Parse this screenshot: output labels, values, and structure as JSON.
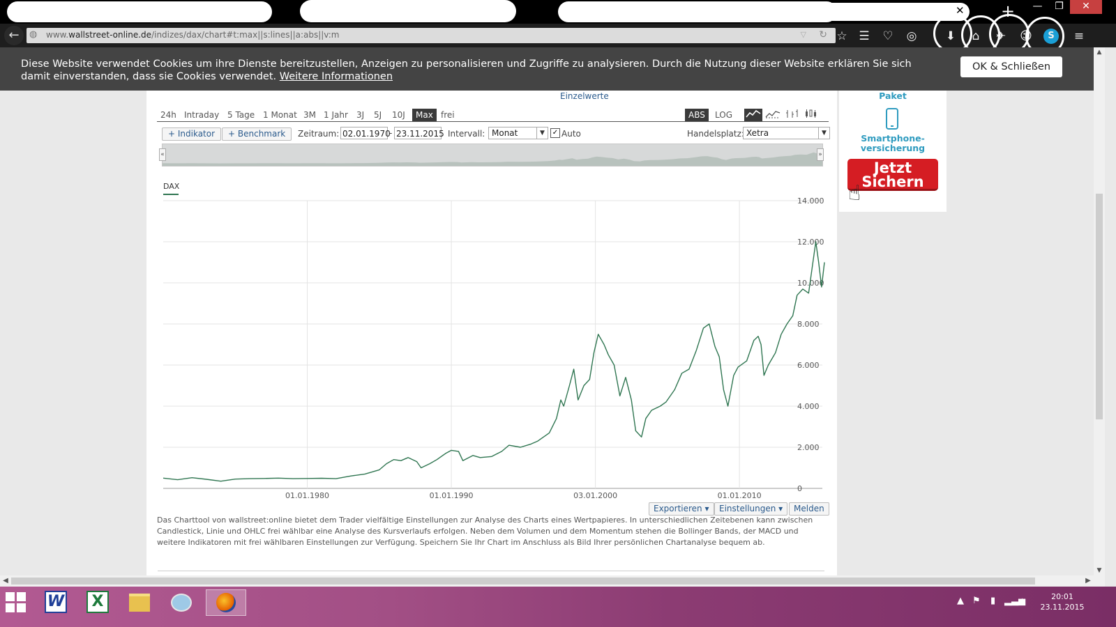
{
  "browser": {
    "tab_glyphs": {
      "close": "✕",
      "new_tab": "+",
      "minimize": "—",
      "restore": "❐",
      "close_window": "✕"
    },
    "url": {
      "prefix": "www.",
      "domain": "wallstreet-online.de",
      "path": "/indizes/dax/chart#t:max||s:lines||a:abs||v:m"
    },
    "toolbar_icons": [
      "star-icon",
      "reading-list-icon",
      "pocket-icon",
      "sync-icon",
      "download-icon",
      "home-icon",
      "send-icon",
      "chat-icon",
      "skype-icon",
      "menu-icon"
    ]
  },
  "cookie_banner": {
    "text": "Diese Website verwendet Cookies um ihre Dienste bereitzustellen, Anzeigen zu personalisieren und Zugriffe zu analysieren. Durch die Nutzung dieser Website erklären Sie sich damit einverstanden, dass sie Cookies verwendet.",
    "link": "Weitere Informationen",
    "button": "OK & Schließen"
  },
  "chart_header": {
    "einzelwerte": "Einzelwerte"
  },
  "range_buttons": [
    "24h",
    "Intraday",
    "5 Tage",
    "1 Monat",
    "3M",
    "1 Jahr",
    "3J",
    "5J",
    "10J",
    "Max",
    "frei"
  ],
  "active_range": "Max",
  "scale_buttons": [
    "ABS",
    "LOG"
  ],
  "active_scale": "ABS",
  "chart_types": [
    "line-chart-icon",
    "mountain-chart-icon",
    "ohlc-chart-icon",
    "candlestick-chart-icon"
  ],
  "controls": {
    "indikator": "+ Indikator",
    "benchmark": "+ Benchmark",
    "zeitraum_label": "Zeitraum:",
    "date_from": "02.01.1970",
    "date_sep": "-",
    "date_to": "23.11.2015",
    "intervall_label": "Intervall:",
    "intervall": "Monat",
    "auto_label": "Auto",
    "auto_checked": true,
    "handelsplatz_label": "Handelsplatz:",
    "handelsplatz": "Xetra",
    "nav_left": "«",
    "nav_right": "»"
  },
  "chart_data": {
    "type": "line",
    "title": "",
    "xlabel": "",
    "ylabel": "",
    "legend": [
      "DAX"
    ],
    "color": "#2e7550",
    "x_ticks": [
      "01.01.1980",
      "01.01.1990",
      "03.01.2000",
      "01.01.2010"
    ],
    "y_ticks": [
      "14.000",
      "12.000",
      "10.000",
      "8.000",
      "6.000",
      "4.000",
      "2.000",
      "0"
    ],
    "ylim": [
      0,
      14000
    ],
    "xlim": [
      1970.0,
      2015.9
    ],
    "series": [
      {
        "name": "DAX",
        "x": [
          1970.0,
          1971.0,
          1972.0,
          1973.0,
          1974.0,
          1975.0,
          1976.0,
          1977.0,
          1978.0,
          1979.0,
          1980.0,
          1981.0,
          1982.0,
          1983.0,
          1984.0,
          1985.0,
          1985.5,
          1986.0,
          1986.5,
          1987.0,
          1987.6,
          1987.9,
          1988.5,
          1989.0,
          1989.6,
          1990.0,
          1990.5,
          1990.8,
          1991.5,
          1992.0,
          1992.8,
          1993.5,
          1994.0,
          1994.8,
          1995.5,
          1996.0,
          1996.8,
          1997.3,
          1997.6,
          1997.8,
          1998.2,
          1998.5,
          1998.8,
          1999.2,
          1999.6,
          1999.9,
          2000.2,
          2000.6,
          2000.9,
          2001.3,
          2001.7,
          2002.1,
          2002.5,
          2002.8,
          2003.2,
          2003.5,
          2003.9,
          2004.5,
          2004.9,
          2005.5,
          2006.0,
          2006.5,
          2007.0,
          2007.5,
          2007.9,
          2008.3,
          2008.6,
          2008.9,
          2009.2,
          2009.6,
          2009.9,
          2010.5,
          2011.0,
          2011.3,
          2011.5,
          2011.7,
          2012.0,
          2012.5,
          2012.9,
          2013.3,
          2013.7,
          2014.0,
          2014.4,
          2014.8,
          2015.0,
          2015.3,
          2015.5,
          2015.7,
          2015.9
        ],
        "values": [
          500,
          420,
          520,
          440,
          350,
          450,
          470,
          480,
          500,
          470,
          480,
          490,
          470,
          600,
          700,
          900,
          1200,
          1400,
          1350,
          1500,
          1300,
          1000,
          1200,
          1400,
          1700,
          1850,
          1800,
          1350,
          1600,
          1500,
          1550,
          1800,
          2100,
          2000,
          2150,
          2300,
          2700,
          3400,
          4300,
          4000,
          5000,
          5800,
          4300,
          5000,
          5300,
          6600,
          7500,
          7000,
          6500,
          6000,
          4500,
          5400,
          4300,
          2800,
          2500,
          3400,
          3800,
          4000,
          4200,
          4800,
          5600,
          5800,
          6700,
          7800,
          8000,
          6900,
          6400,
          4800,
          4000,
          5500,
          5900,
          6200,
          7200,
          7400,
          7000,
          5500,
          6000,
          6600,
          7500,
          8000,
          8400,
          9400,
          9700,
          9500,
          10500,
          12000,
          11000,
          9800,
          11000
        ]
      }
    ]
  },
  "chart_tools": {
    "exportieren": "Exportieren ▾",
    "einstellungen": "Einstellungen ▾",
    "melden": "Melden"
  },
  "description": "Das Charttool von wallstreet:online bietet dem Trader vielfältige Einstellungen zur Analyse des Charts eines Wertpapieres. In unterschiedlichen Zeitebenen kann zwischen Candlestick, Linie und OHLC frei wählbar eine Analyse des Kursverlaufs erfolgen. Neben dem Volumen und dem Momentum stehen die Bollinger Bands, der MACD und weitere Indikatoren mit frei wählbaren Einstellungen zur Verfügung. Speichern Sie Ihr Chart im Anschluss als Bild Ihrer persönlichen Chartanalyse bequem ab.",
  "sidebar": {
    "paket": "Paket",
    "smartphone_line1": "Smartphone-",
    "smartphone_line2": "versicherung",
    "cta_line1": "Jetzt",
    "cta_line2": "Sichern"
  },
  "taskbar": {
    "apps": [
      "start-icon",
      "word-icon",
      "excel-icon",
      "explorer-icon",
      "paint-icon",
      "firefox-icon"
    ],
    "word_glyph": "W",
    "excel_glyph": "X",
    "time": "20:01",
    "date": "23.11.2015"
  }
}
